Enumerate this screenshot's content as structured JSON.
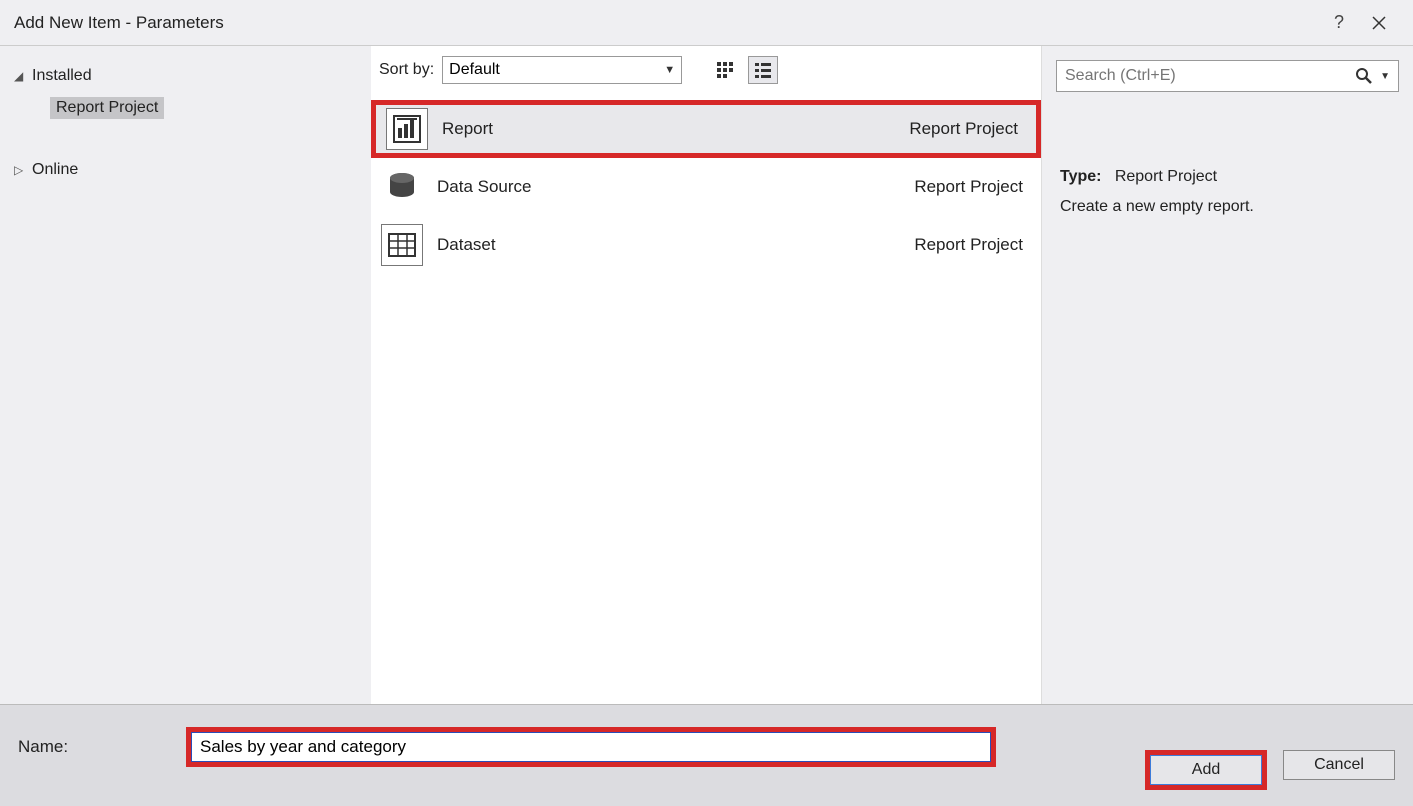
{
  "window": {
    "title": "Add New Item - Parameters"
  },
  "sidebar": {
    "items": [
      {
        "label": "Installed",
        "expanded": true
      },
      {
        "label": "Report Project",
        "selected": true
      },
      {
        "label": "Online",
        "expanded": false
      }
    ]
  },
  "toolbar": {
    "sort_label": "Sort by:",
    "sort_value": "Default"
  },
  "search": {
    "placeholder": "Search (Ctrl+E)"
  },
  "templates": [
    {
      "name": "Report",
      "category": "Report Project",
      "selected": true
    },
    {
      "name": "Data Source",
      "category": "Report Project",
      "selected": false
    },
    {
      "name": "Dataset",
      "category": "Report Project",
      "selected": false
    }
  ],
  "details": {
    "type_label": "Type:",
    "type_value": "Report Project",
    "description": "Create a new empty report."
  },
  "footer": {
    "name_label": "Name:",
    "name_value": "Sales by year and category",
    "add_label": "Add",
    "cancel_label": "Cancel"
  }
}
